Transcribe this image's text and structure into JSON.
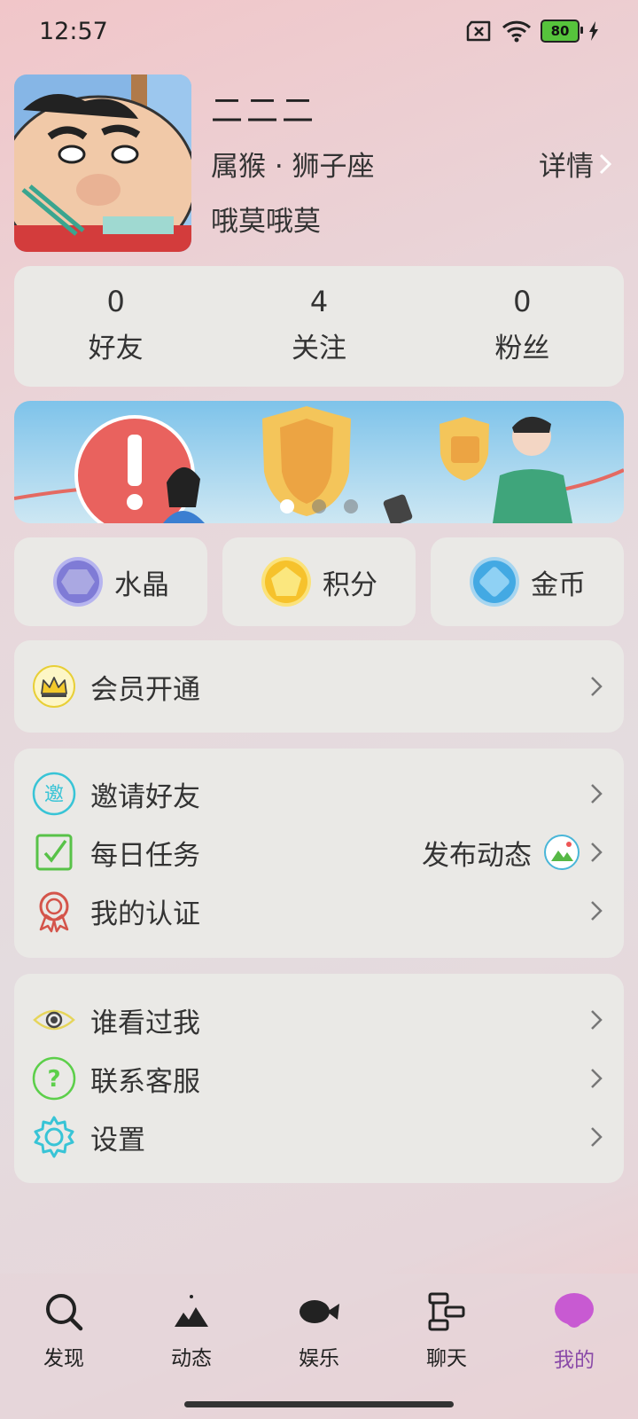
{
  "status": {
    "time": "12:57",
    "battery": "80"
  },
  "profile": {
    "name": "二二二",
    "info": "属猴 · 狮子座",
    "detail": "详情",
    "signature": "哦莫哦莫"
  },
  "stats": [
    {
      "num": "0",
      "label": "好友"
    },
    {
      "num": "4",
      "label": "关注"
    },
    {
      "num": "0",
      "label": "粉丝"
    }
  ],
  "wallet": [
    {
      "label": "水晶",
      "icon": "crystal-icon"
    },
    {
      "label": "积分",
      "icon": "points-icon"
    },
    {
      "label": "金币",
      "icon": "coin-icon"
    }
  ],
  "menu": {
    "vip": "会员开通",
    "invite": "邀请好友",
    "invite_badge": "邀",
    "daily": "每日任务",
    "daily_extra": "发布动态",
    "cert": "我的认证",
    "viewers": "谁看过我",
    "service": "联系客服",
    "service_badge": "?",
    "settings": "设置"
  },
  "nav": [
    {
      "label": "发现"
    },
    {
      "label": "动态"
    },
    {
      "label": "娱乐"
    },
    {
      "label": "聊天"
    },
    {
      "label": "我的"
    }
  ],
  "colors": {
    "active_tab": "#8a4aa8",
    "card": "#eae9e6"
  }
}
